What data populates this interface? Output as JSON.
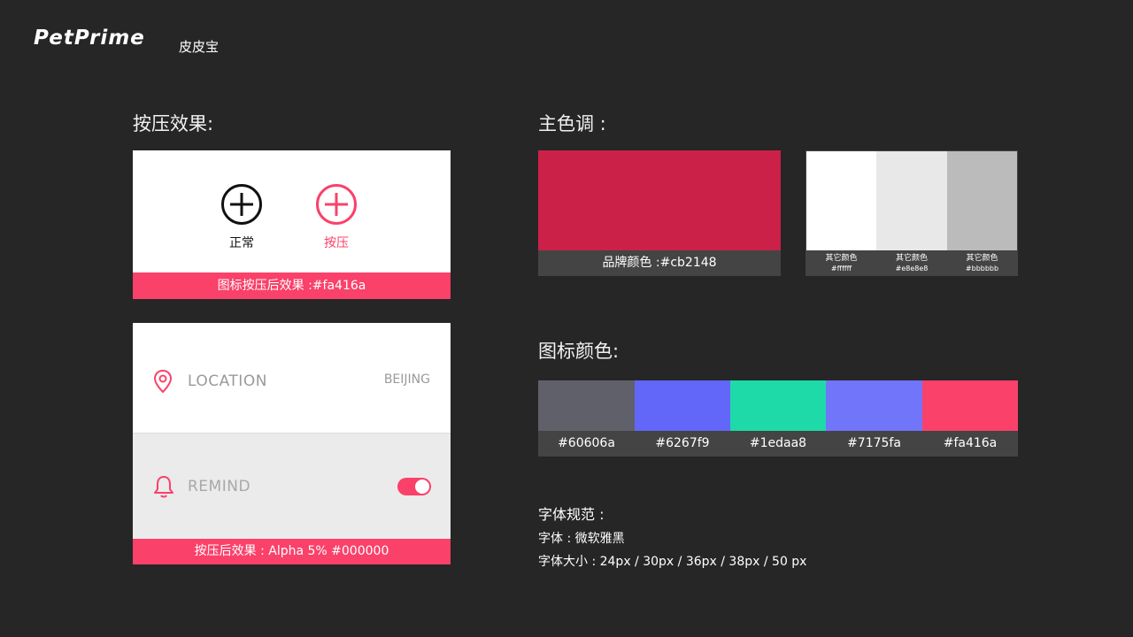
{
  "header": {
    "logo_text": "PetPrime",
    "logo_sub": "皮皮宝"
  },
  "press_section": {
    "title": "按压效果:",
    "normal_label": "正常",
    "pressed_label": "按压",
    "banner": "图标按压后效果 :#fa416a"
  },
  "list_card": {
    "location_label": "LOCATION",
    "location_value": "BEIJING",
    "remind_label": "REMIND",
    "banner": "按压后效果 : Alpha 5% #000000"
  },
  "main_color": {
    "title": "主色调 :",
    "brand_caption": "品牌颜色 :#cb2148",
    "brand_color": "#cb2148",
    "others": [
      {
        "label": "其它颜色",
        "hex": "#ffffff",
        "color": "#ffffff"
      },
      {
        "label": "其它颜色",
        "hex": "#e8e8e8",
        "color": "#e8e8e8"
      },
      {
        "label": "其它颜色",
        "hex": "#bbbbbb",
        "color": "#bbbbbb"
      }
    ]
  },
  "icon_colors": {
    "title": "图标颜色:",
    "swatches": [
      {
        "hex": "#60606a",
        "color": "#60606a"
      },
      {
        "hex": "#6267f9",
        "color": "#6267f9"
      },
      {
        "hex": "#1edaa8",
        "color": "#1edaa8"
      },
      {
        "hex": "#7175fa",
        "color": "#7175fa"
      },
      {
        "hex": "#fa416a",
        "color": "#fa416a"
      }
    ]
  },
  "font_spec": {
    "title": "字体规范 :",
    "font_line": "字体 : 微软雅黑",
    "size_line": "字体大小 : 24px / 30px / 36px / 38px / 50 px"
  },
  "colors": {
    "accent": "#fa416a",
    "background": "#262626",
    "bar": "#444444"
  }
}
